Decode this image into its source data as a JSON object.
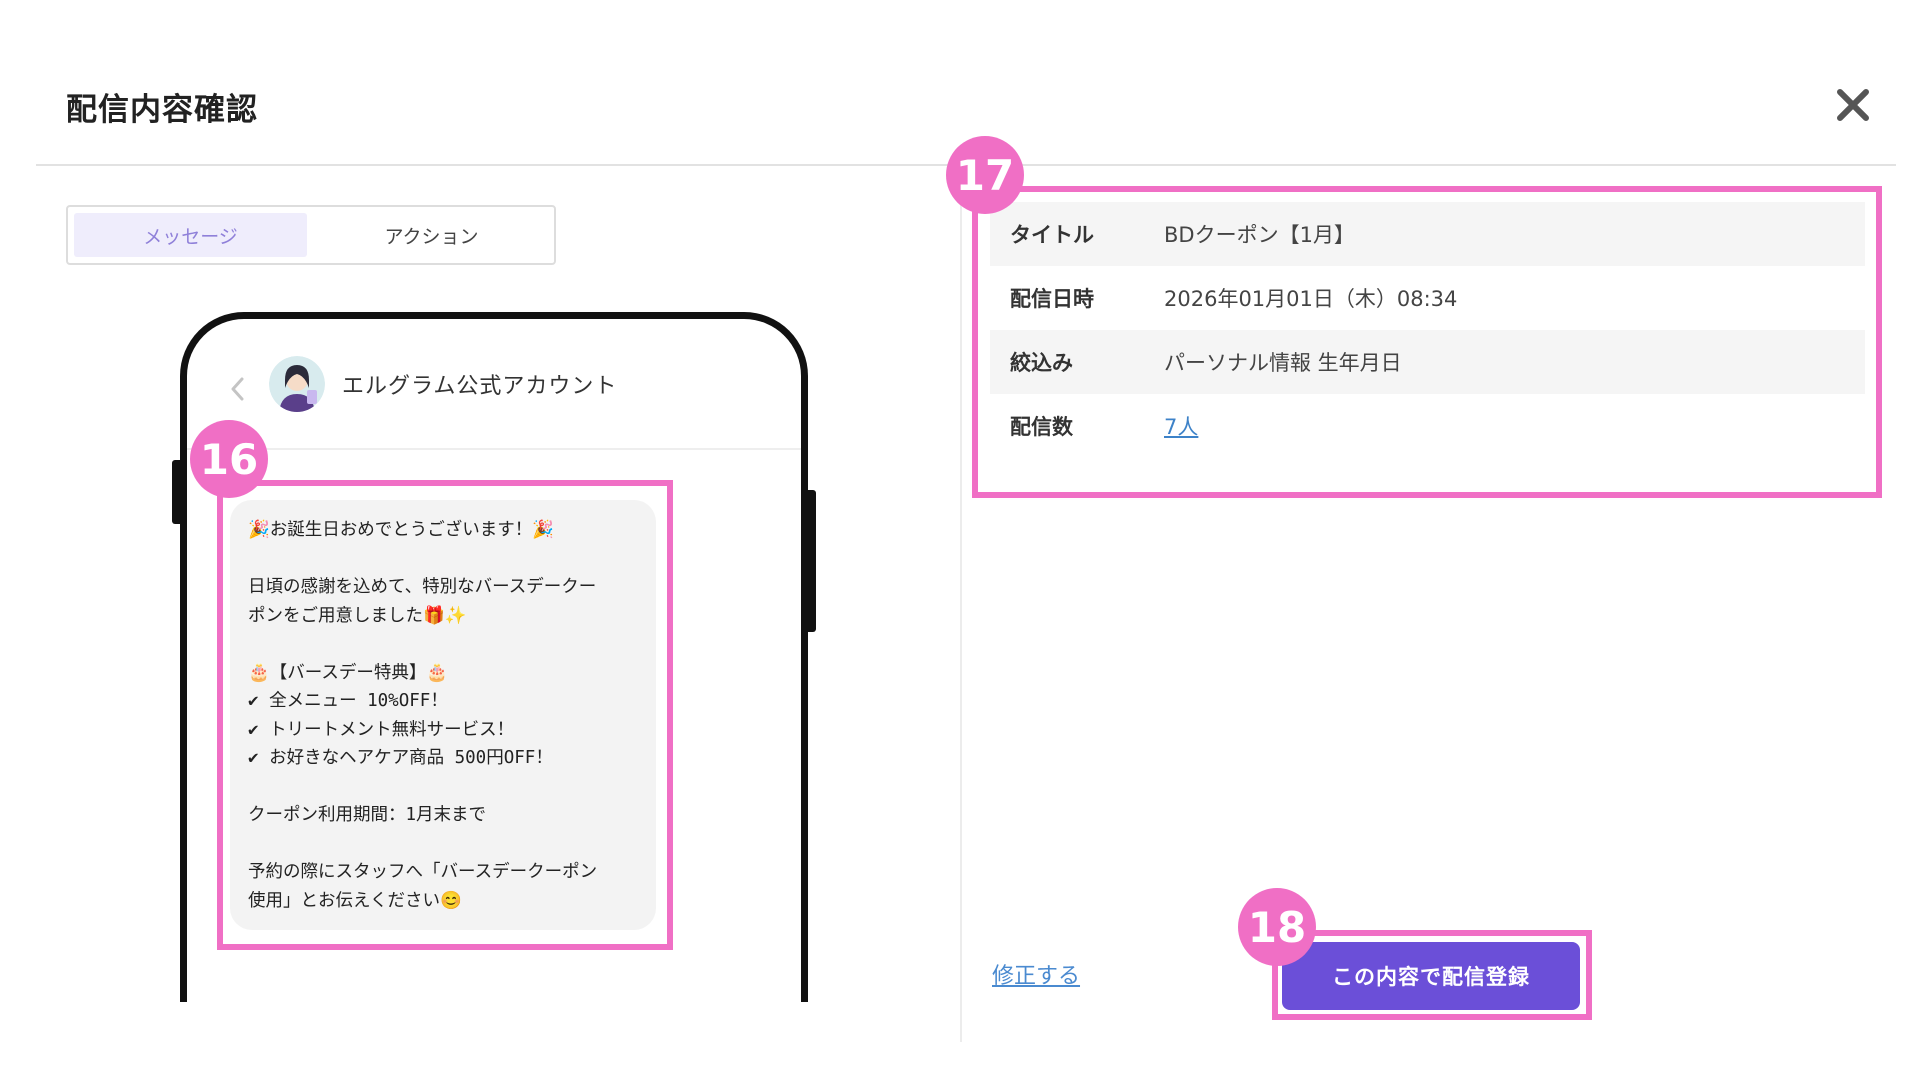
{
  "modal": {
    "title": "配信内容確認",
    "close_icon": "close-icon"
  },
  "tabs": [
    {
      "label": "メッセージ",
      "active": true
    },
    {
      "label": "アクション",
      "active": false
    }
  ],
  "preview": {
    "account_name": "エルグラム公式アカウント",
    "back_icon": "chevron-left-icon",
    "message_text": "🎉お誕生日おめでとうございます！🎉\n\n日頃の感謝を込めて、特別なバースデークー\nポンをご用意しました🎁✨\n\n🎂【バースデー特典】🎂\n✔ 全メニュー 10%OFF！\n✔ トリートメント無料サービス！\n✔ お好きなヘアケア商品 500円OFF！\n\nクーポン利用期間：1月末まで\n\n予約の際にスタッフへ「バースデークーポン\n使用」とお伝えください😊"
  },
  "info": [
    {
      "label": "タイトル",
      "value": "BDクーポン【1月】"
    },
    {
      "label": "配信日時",
      "value": "2026年01月01日（木）08:34"
    },
    {
      "label": "絞込み",
      "value": "パーソナル情報 生年月日"
    },
    {
      "label": "配信数",
      "value": "7人",
      "link": true
    }
  ],
  "actions": {
    "edit_label": "修正する",
    "submit_label": "この内容で配信登録"
  },
  "callouts": [
    "16",
    "17",
    "18"
  ],
  "colors": {
    "accent": "#6b4fd8",
    "callout": "#f06fc5",
    "tab_active_bg": "#efedfc",
    "tab_active_text": "#8f80d9",
    "link": "#3d82c8"
  }
}
